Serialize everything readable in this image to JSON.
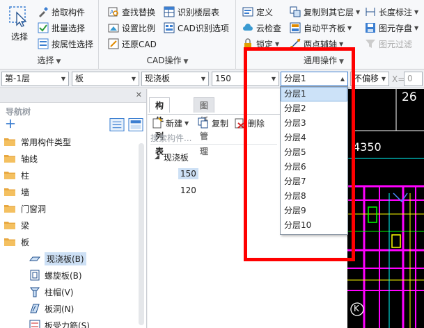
{
  "ribbon": {
    "select_group": {
      "big_button": "选择",
      "buttons": [
        "拾取构件",
        "批量选择",
        "按属性选择"
      ],
      "title": "选择"
    },
    "cad_group": {
      "col1": [
        "查找替换",
        "设置比例",
        "还原CAD"
      ],
      "col2": [
        "识别楼层表",
        "CAD识别选项"
      ],
      "title": "CAD操作"
    },
    "common_group": {
      "col1": [
        "定义",
        "云检查",
        "锁定"
      ],
      "col2": [
        "复制到其它层",
        "自动平齐板",
        "两点辅轴"
      ],
      "col3": [
        "长度标注",
        "图元存盘",
        "图元过滤"
      ],
      "title": "通用操作"
    }
  },
  "toolbar": {
    "floor": "第-1层",
    "type": "板",
    "subtype": "现浇板",
    "value": "150",
    "layer": "分层1",
    "offset": "不偏移",
    "x_label": "X=",
    "x_value": "0"
  },
  "layer_options": [
    "分层1",
    "分层2",
    "分层3",
    "分层4",
    "分层5",
    "分层6",
    "分层7",
    "分层8",
    "分层9",
    "分层10"
  ],
  "nav": {
    "title": "导航树",
    "items": [
      "常用构件类型",
      "轴线",
      "柱",
      "墙",
      "门窗洞",
      "梁",
      "板"
    ],
    "sub_items": [
      "现浇板(B)",
      "螺旋板(B)",
      "柱帽(V)",
      "板洞(N)",
      "板受力筋(S)"
    ]
  },
  "components": {
    "tabs": [
      "构件列表",
      "图纸管理"
    ],
    "actions": [
      "新建",
      "复制",
      "删除"
    ],
    "search_placeholder": "搜索构件...",
    "tree_root": "现浇板",
    "tree_children": [
      "150",
      "120"
    ]
  },
  "cad": {
    "numbers": [
      "26",
      "4350"
    ],
    "axis_label": "K"
  },
  "colors": {
    "highlight_red": "#ff0000",
    "selection_blue": "#cce2f8",
    "cad_bg": "#000000"
  }
}
